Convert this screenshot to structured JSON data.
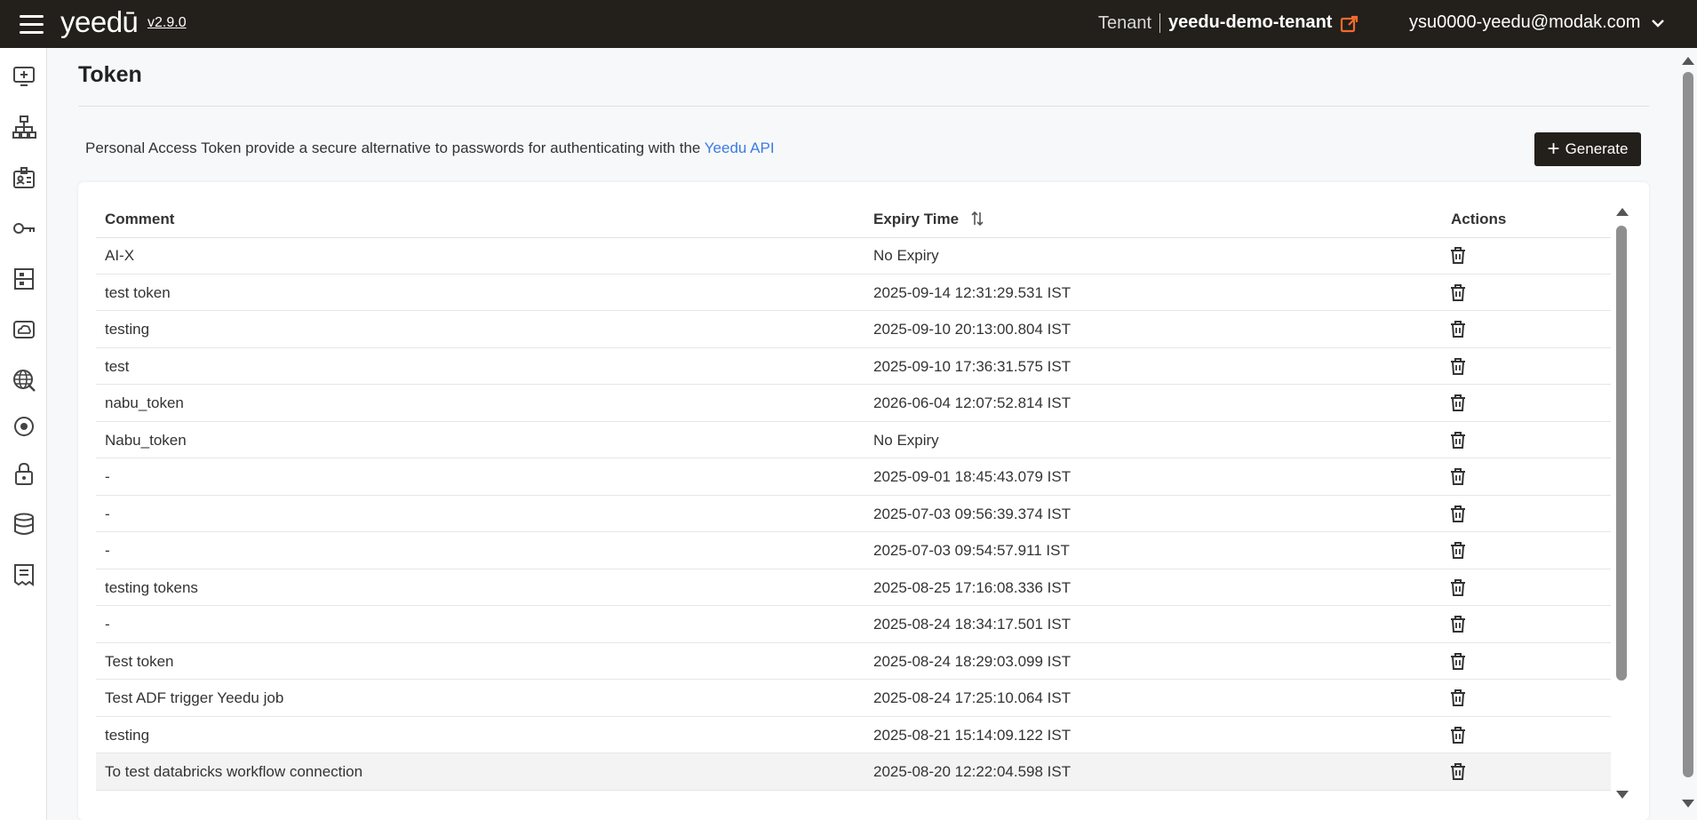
{
  "header": {
    "brand": "yeedū",
    "version": "v2.9.0",
    "tenant_label": "Tenant",
    "tenant_name": "yeedu-demo-tenant",
    "user_email": "ysu0000-yeedu@modak.com"
  },
  "sidebar": {
    "items": [
      {
        "icon": "add-screen-icon"
      },
      {
        "icon": "cluster-hierarchy-icon"
      },
      {
        "icon": "id-badge-icon"
      },
      {
        "icon": "key-icon"
      },
      {
        "icon": "building-icon"
      },
      {
        "icon": "cloud-drive-icon"
      },
      {
        "icon": "network-globe-icon"
      },
      {
        "icon": "target-icon"
      },
      {
        "icon": "lock-icon"
      },
      {
        "icon": "database-icon"
      },
      {
        "icon": "receipt-icon"
      }
    ]
  },
  "page": {
    "title": "Token",
    "description": "Personal Access Token provide a secure alternative to passwords for authenticating with the",
    "description_link": "Yeedu API",
    "generate_label": "Generate"
  },
  "table": {
    "columns": {
      "comment": "Comment",
      "expiry": "Expiry Time",
      "actions": "Actions"
    },
    "rows": [
      {
        "comment": "AI-X",
        "expiry": "No Expiry"
      },
      {
        "comment": "test token",
        "expiry": "2025-09-14 12:31:29.531 IST"
      },
      {
        "comment": "testing",
        "expiry": "2025-09-10 20:13:00.804 IST"
      },
      {
        "comment": "test",
        "expiry": "2025-09-10 17:36:31.575 IST"
      },
      {
        "comment": "nabu_token",
        "expiry": "2026-06-04 12:07:52.814 IST"
      },
      {
        "comment": "Nabu_token",
        "expiry": "No Expiry"
      },
      {
        "comment": "-",
        "expiry": "2025-09-01 18:45:43.079 IST"
      },
      {
        "comment": "-",
        "expiry": "2025-07-03 09:56:39.374 IST"
      },
      {
        "comment": "-",
        "expiry": "2025-07-03 09:54:57.911 IST"
      },
      {
        "comment": "testing tokens",
        "expiry": "2025-08-25 17:16:08.336 IST"
      },
      {
        "comment": "-",
        "expiry": "2025-08-24 18:34:17.501 IST"
      },
      {
        "comment": "Test token",
        "expiry": "2025-08-24 18:29:03.099 IST"
      },
      {
        "comment": "Test ADF trigger Yeedu job",
        "expiry": "2025-08-24 17:25:10.064 IST"
      },
      {
        "comment": "testing",
        "expiry": "2025-08-21 15:14:09.122 IST"
      },
      {
        "comment": "To test databricks workflow connection",
        "expiry": "2025-08-20 12:22:04.598 IST"
      }
    ]
  },
  "colors": {
    "topbar": "#231f1b",
    "accent": "#f26b2a",
    "link": "#3b7be0"
  }
}
